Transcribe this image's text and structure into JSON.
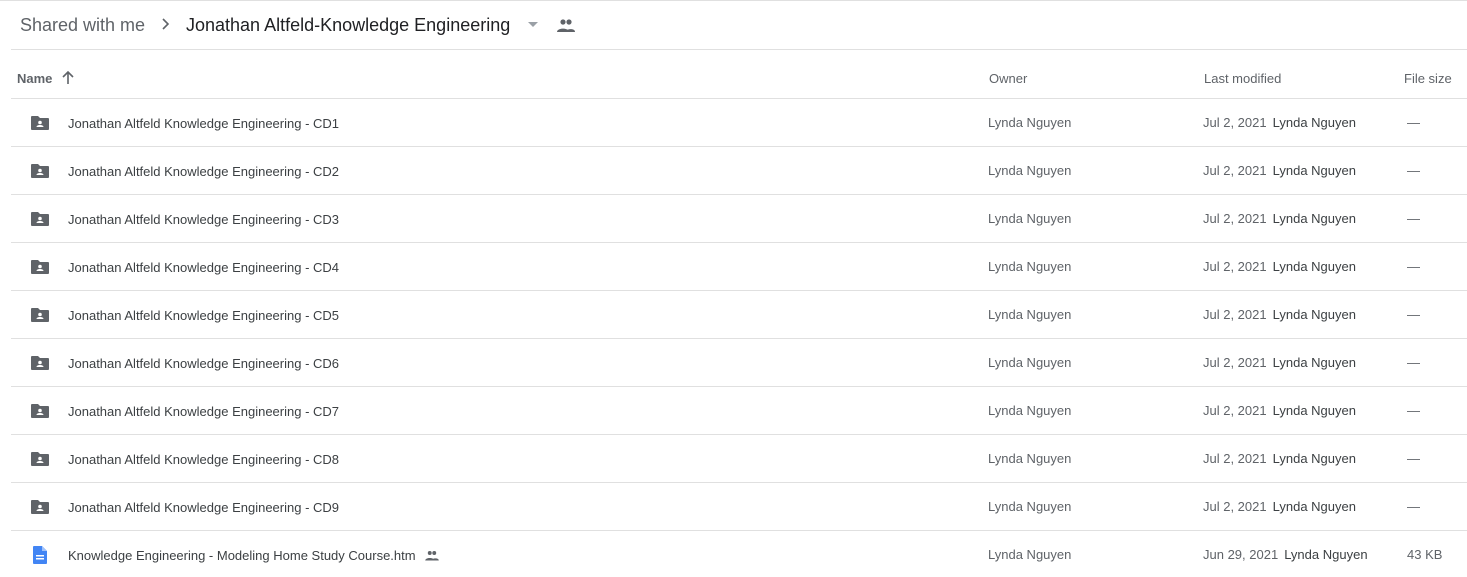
{
  "breadcrumb": {
    "root": "Shared with me",
    "current": "Jonathan Altfeld-Knowledge Engineering",
    "separator_icon": "chevron-right-icon",
    "caret_icon": "arrow-drop-down-icon",
    "shared_icon": "people-icon"
  },
  "columns": {
    "name": "Name",
    "sort_icon": "arrow-upward-icon",
    "owner": "Owner",
    "last_modified": "Last modified",
    "file_size": "File size"
  },
  "colors": {
    "folder_icon": "#5f6368",
    "doc_icon": "#4285f4",
    "divider": "#e0e0e0"
  },
  "rows": [
    {
      "icon": "shared-folder-icon",
      "name": "Jonathan Altfeld Knowledge Engineering - CD1",
      "owner": "Lynda Nguyen",
      "modified_date": "Jul 2, 2021",
      "modified_by": "Lynda Nguyen",
      "size": "—",
      "shared": false
    },
    {
      "icon": "shared-folder-icon",
      "name": "Jonathan Altfeld Knowledge Engineering - CD2",
      "owner": "Lynda Nguyen",
      "modified_date": "Jul 2, 2021",
      "modified_by": "Lynda Nguyen",
      "size": "—",
      "shared": false
    },
    {
      "icon": "shared-folder-icon",
      "name": "Jonathan Altfeld Knowledge Engineering - CD3",
      "owner": "Lynda Nguyen",
      "modified_date": "Jul 2, 2021",
      "modified_by": "Lynda Nguyen",
      "size": "—",
      "shared": false
    },
    {
      "icon": "shared-folder-icon",
      "name": "Jonathan Altfeld Knowledge Engineering - CD4",
      "owner": "Lynda Nguyen",
      "modified_date": "Jul 2, 2021",
      "modified_by": "Lynda Nguyen",
      "size": "—",
      "shared": false
    },
    {
      "icon": "shared-folder-icon",
      "name": "Jonathan Altfeld Knowledge Engineering - CD5",
      "owner": "Lynda Nguyen",
      "modified_date": "Jul 2, 2021",
      "modified_by": "Lynda Nguyen",
      "size": "—",
      "shared": false
    },
    {
      "icon": "shared-folder-icon",
      "name": "Jonathan Altfeld Knowledge Engineering - CD6",
      "owner": "Lynda Nguyen",
      "modified_date": "Jul 2, 2021",
      "modified_by": "Lynda Nguyen",
      "size": "—",
      "shared": false
    },
    {
      "icon": "shared-folder-icon",
      "name": "Jonathan Altfeld Knowledge Engineering - CD7",
      "owner": "Lynda Nguyen",
      "modified_date": "Jul 2, 2021",
      "modified_by": "Lynda Nguyen",
      "size": "—",
      "shared": false
    },
    {
      "icon": "shared-folder-icon",
      "name": "Jonathan Altfeld Knowledge Engineering - CD8",
      "owner": "Lynda Nguyen",
      "modified_date": "Jul 2, 2021",
      "modified_by": "Lynda Nguyen",
      "size": "—",
      "shared": false
    },
    {
      "icon": "shared-folder-icon",
      "name": "Jonathan Altfeld Knowledge Engineering - CD9",
      "owner": "Lynda Nguyen",
      "modified_date": "Jul 2, 2021",
      "modified_by": "Lynda Nguyen",
      "size": "—",
      "shared": false
    },
    {
      "icon": "google-doc-icon",
      "name": "Knowledge Engineering - Modeling Home Study Course.htm",
      "owner": "Lynda Nguyen",
      "modified_date": "Jun 29, 2021",
      "modified_by": "Lynda Nguyen",
      "size": "43 KB",
      "shared": true
    }
  ]
}
